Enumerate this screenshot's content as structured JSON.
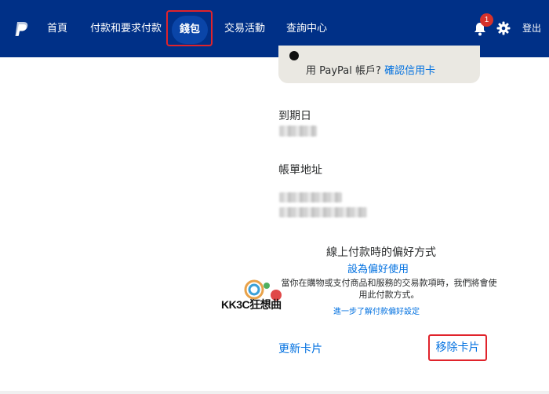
{
  "nav": {
    "items": [
      {
        "label": "首頁"
      },
      {
        "label": "付款和要求付款"
      },
      {
        "label": "錢包",
        "active": true
      },
      {
        "label": "交易活動"
      },
      {
        "label": "查詢中心"
      }
    ],
    "notification_count": "1",
    "logout_label": "登出",
    "icons": {
      "logo": "paypal-logo-icon",
      "bell": "bell-icon",
      "settings": "gear-icon"
    },
    "colors": {
      "bar": "#003087",
      "active_pill": "#0a45a8",
      "badge": "#d6322b",
      "highlight": "#e0232b"
    }
  },
  "notice": {
    "line2_prefix": "用 PayPal 帳戶?",
    "link": "確認信用卡"
  },
  "card": {
    "expiry_label": "到期日",
    "billing_label": "帳單地址"
  },
  "preference": {
    "title": "線上付款時的偏好方式",
    "set_link": "設為偏好使用",
    "description": "當你在購物或支付商品和服務的交易款項時，我們將會使用此付款方式。",
    "more_link": "進一步了解付款偏好設定"
  },
  "watermark": {
    "text": "KK3C狂想曲"
  },
  "actions": {
    "update_card": "更新卡片",
    "remove_card": "移除卡片"
  },
  "colors": {
    "link": "#0070e0",
    "notice_bg": "#eae8e2"
  }
}
